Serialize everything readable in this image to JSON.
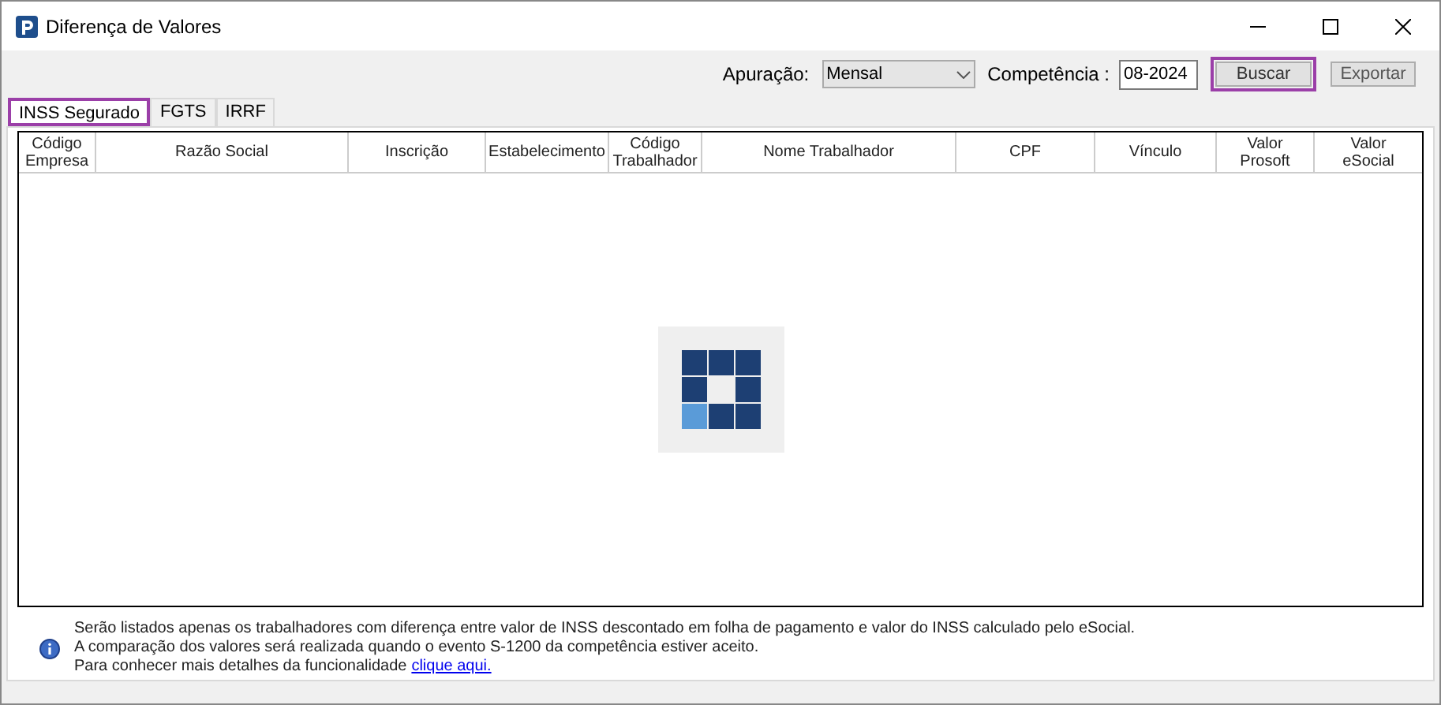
{
  "window": {
    "title": "Diferença de Valores"
  },
  "toolbar": {
    "apuracao_label": "Apuração:",
    "apuracao_value": "Mensal",
    "competencia_label": "Competência :",
    "competencia_value": "08-2024",
    "buttons": [
      {
        "label": "Buscar",
        "highlighted": true
      },
      {
        "label": "Exportar",
        "highlighted": false
      }
    ]
  },
  "tabs": [
    {
      "label": "INSS Segurado",
      "selected": true
    },
    {
      "label": "FGTS",
      "selected": false
    },
    {
      "label": "IRRF",
      "selected": false
    }
  ],
  "table": {
    "columns": [
      "Código Empresa",
      "Razão Social",
      "Inscrição",
      "Estabelecimento",
      "Código Trabalhador",
      "Nome Trabalhador",
      "CPF",
      "Vínculo",
      "Valor Prosoft",
      "Valor eSocial"
    ]
  },
  "info": {
    "lines": [
      "Serão listados apenas os trabalhadores com diferença entre valor de INSS descontado em folha de pagamento e valor do INSS calculado pelo eSocial.",
      "A comparação dos valores será realizada quando o evento S-1200 da competência estiver aceito.",
      "Para conhecer mais detalhes da funcionalidade"
    ],
    "link": "clique aqui."
  }
}
